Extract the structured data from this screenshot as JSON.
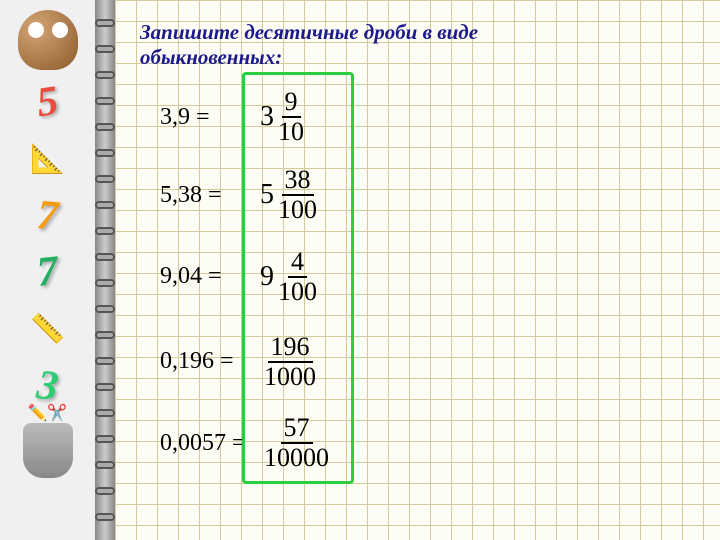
{
  "title_line1": "Запишите десятичные дроби в виде",
  "title_line2": "обыкновенных:",
  "sidebar_numbers": [
    "5",
    "7",
    "7",
    "3"
  ],
  "problems": [
    {
      "decimal": "3,9 =",
      "whole": "3",
      "num": "9",
      "den": "10"
    },
    {
      "decimal": "5,38 =",
      "whole": "5",
      "num": "38",
      "den": "100"
    },
    {
      "decimal": "9,04 =",
      "whole": "9",
      "num": "4",
      "den": "100"
    },
    {
      "decimal": "0,196 =",
      "whole": "",
      "num": "196",
      "den": "1000"
    },
    {
      "decimal": "0,0057 =",
      "whole": "",
      "num": "57",
      "den": "10000"
    }
  ]
}
